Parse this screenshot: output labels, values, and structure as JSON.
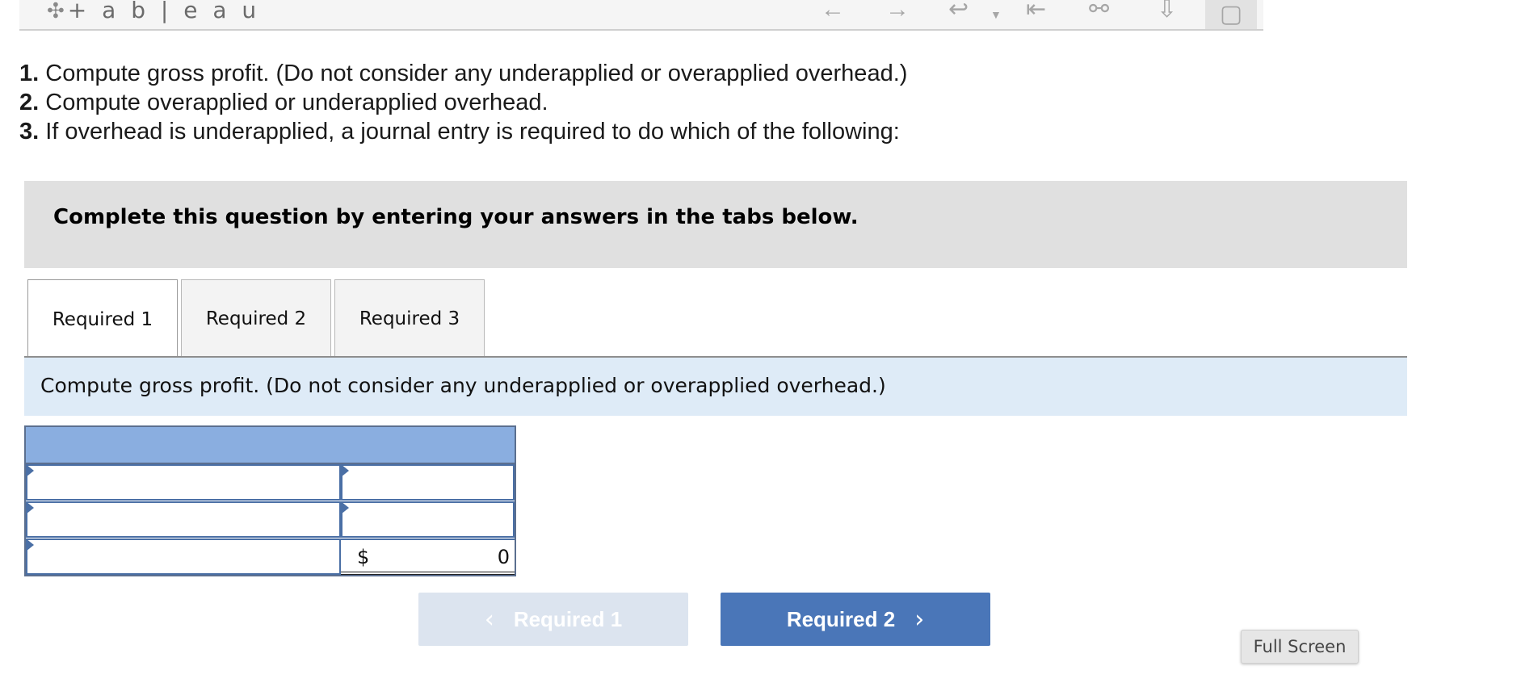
{
  "toolbar": {
    "logo_text": "+ a b | e a u",
    "icons": [
      "undo-arrow-icon",
      "redo-arrow-icon",
      "revert-icon",
      "dropdown-caret-icon",
      "reset-icon",
      "share-icon",
      "download-icon",
      "fullscreen-frame-icon"
    ]
  },
  "questions": [
    {
      "num": "1.",
      "text": " Compute gross profit. (Do not consider any underapplied or overapplied overhead.)"
    },
    {
      "num": "2.",
      "text": " Compute overapplied or underapplied overhead."
    },
    {
      "num": "3.",
      "text": " If overhead is underapplied, a journal entry is required to do which of the following:"
    }
  ],
  "banner": {
    "text": "Complete this question by entering your answers in the tabs below."
  },
  "tabs": [
    {
      "label": "Required 1",
      "active": true
    },
    {
      "label": "Required 2",
      "active": false
    },
    {
      "label": "Required 3",
      "active": false
    }
  ],
  "prompt": {
    "text": "Compute gross profit. (Do not consider any underapplied or overapplied overhead.)"
  },
  "answer_table": {
    "rows": [
      {
        "label": "",
        "value": ""
      },
      {
        "label": "",
        "value": ""
      },
      {
        "label": "",
        "currency": "$",
        "value": "0"
      }
    ]
  },
  "nav": {
    "prev_label": "Required 1",
    "next_label": "Required 2",
    "prev_chevron": "‹",
    "next_chevron": "›"
  },
  "fullscreen_label": "Full Screen",
  "colors": {
    "accent": "#4a76b8",
    "header_row": "#8aaee0",
    "prompt_bg": "#deebf7",
    "banner_bg": "#e0e0e0"
  }
}
